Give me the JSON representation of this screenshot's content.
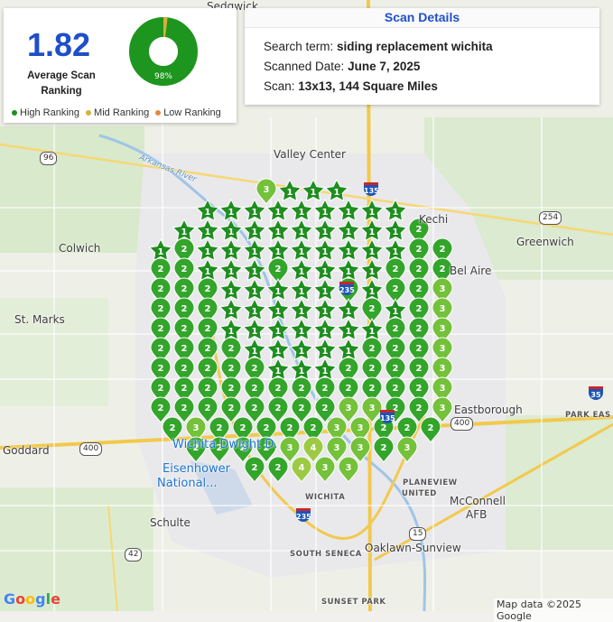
{
  "summary": {
    "average_value": "1.82",
    "average_label": "Average Scan Ranking",
    "donut": {
      "high_pct": 98,
      "mid_pct": 2,
      "high_text": "98%",
      "mid_text": "2%"
    },
    "legend": [
      {
        "label": "High Ranking",
        "color": "#1e8f22"
      },
      {
        "label": "Mid Ranking",
        "color": "#d6b039"
      },
      {
        "label": "Low Ranking",
        "color": "#e48b3c"
      }
    ]
  },
  "details": {
    "title": "Scan Details",
    "search_term_label": "Search term:",
    "search_term": "siding replacement wichita",
    "date_label": "Scanned Date:",
    "date": "June 7, 2025",
    "scan_label": "Scan:",
    "scan": "13x13, 144 Square Miles"
  },
  "map": {
    "places": {
      "sedgwick": "Sedgwick",
      "valley_center": "Valley Center",
      "arkansas_river": "Arkansas River",
      "colwich": "Colwich",
      "kechi": "Kechi",
      "greenwich": "Greenwich",
      "bel_aire": "Bel Aire",
      "st_marks": "St. Marks",
      "park_east": "PARK EAS",
      "eastborough": "Eastborough",
      "goddard": "Goddard",
      "airport_1": "Wichita Dwight D.",
      "airport_2": "Eisenhower",
      "airport_3": "National...",
      "planeview": "PLANEVIEW",
      "united": "UNITED",
      "mcconnell": "McConnell",
      "afb": "AFB",
      "schulte": "Schulte",
      "south_seneca": "SOUTH SENECA",
      "oaklawn": "Oaklawn-Sunview",
      "sunset_park": "SUNSET PARK",
      "south_wichita": "WICHITA"
    },
    "roads": {
      "r96": "96",
      "r254": "254",
      "r400a": "400",
      "r400b": "400",
      "r42": "42",
      "r15": "15",
      "i135a": "135",
      "i135b": "135",
      "i235a": "235",
      "i235b": "235",
      "i35": "35"
    },
    "attribution": "Map data ©2025 Google",
    "google_logo": "Google"
  },
  "grid": {
    "size": "13x13",
    "colors": {
      "1": "#1e8e1e",
      "2": "#33a52a",
      "3": "#74c13a",
      "4": "#9ccb43"
    },
    "rows": [
      [
        3,
        1,
        1,
        1
      ],
      [
        1,
        1,
        1,
        1,
        1,
        1,
        1,
        1,
        1
      ],
      [
        1,
        1,
        1,
        1,
        1,
        1,
        1,
        1,
        1,
        1,
        2
      ],
      [
        1,
        2,
        1,
        1,
        1,
        1,
        1,
        1,
        1,
        1,
        1,
        2,
        2
      ],
      [
        2,
        2,
        1,
        1,
        1,
        2,
        1,
        1,
        1,
        1,
        2,
        2,
        2
      ],
      [
        2,
        2,
        2,
        1,
        1,
        1,
        1,
        1,
        2,
        1,
        2,
        2,
        3
      ],
      [
        2,
        2,
        2,
        1,
        1,
        1,
        1,
        1,
        1,
        2,
        1,
        2,
        3
      ],
      [
        2,
        2,
        2,
        1,
        1,
        1,
        1,
        1,
        1,
        1,
        2,
        2,
        3
      ],
      [
        2,
        2,
        2,
        2,
        1,
        1,
        1,
        1,
        1,
        2,
        2,
        2,
        3
      ],
      [
        2,
        2,
        2,
        2,
        2,
        1,
        1,
        1,
        2,
        2,
        2,
        2,
        3
      ],
      [
        2,
        2,
        2,
        2,
        2,
        2,
        2,
        2,
        2,
        2,
        2,
        2,
        3
      ],
      [
        2,
        2,
        2,
        2,
        2,
        2,
        2,
        2,
        3,
        3,
        2,
        2,
        3
      ],
      [
        2,
        3,
        2,
        2,
        2,
        2,
        2,
        3,
        3,
        2,
        2,
        2
      ],
      [
        2,
        2,
        2,
        2,
        3,
        4,
        3,
        3,
        2,
        3
      ],
      [
        2,
        2,
        4,
        3,
        3
      ]
    ]
  }
}
